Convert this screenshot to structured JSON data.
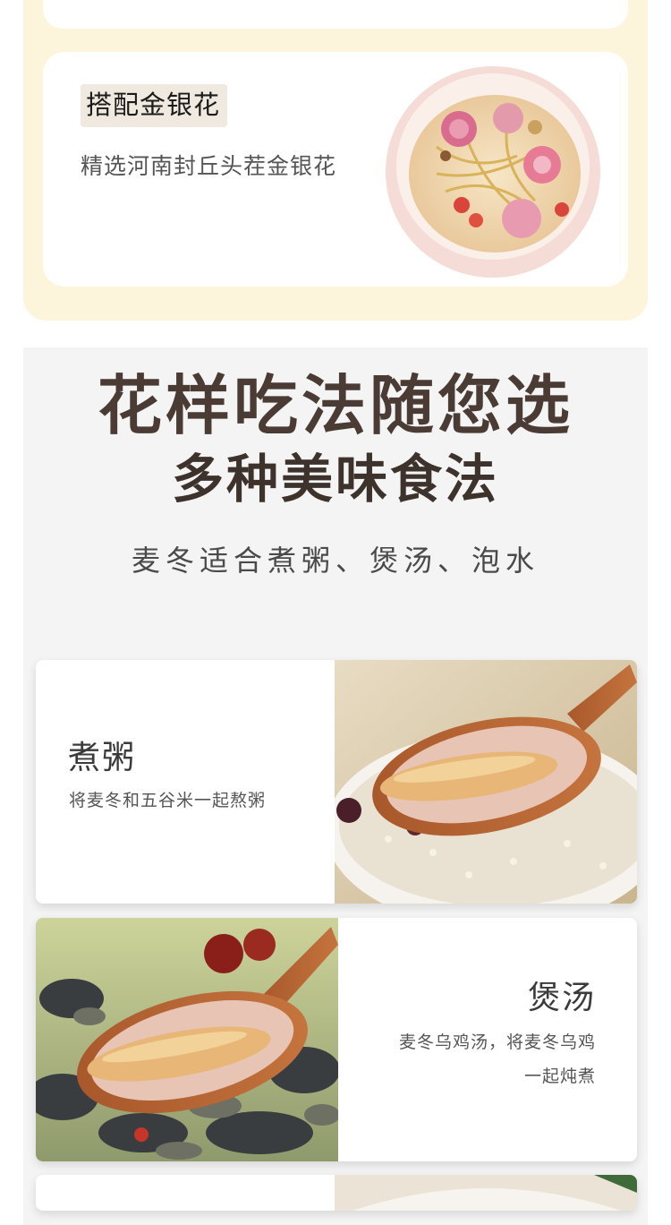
{
  "honeysuckle": {
    "title": "搭配金银花",
    "subtitle": "精选河南封丘头茬金银花"
  },
  "section": {
    "heading": "花样吃法随您选",
    "subheading": "多种美味食法",
    "caption": "麦冬适合煮粥、煲汤、泡水"
  },
  "recipes": [
    {
      "title": "煮粥",
      "desc": "将麦冬和五谷米一起熬粥"
    },
    {
      "title": "煲汤",
      "desc_line1": "麦冬乌鸡汤，将麦冬乌鸡",
      "desc_line2": "一起炖煮"
    }
  ],
  "colors": {
    "cream": "#fdf4dc",
    "grey": "#f4f4f4",
    "heading": "#4a3b34"
  }
}
